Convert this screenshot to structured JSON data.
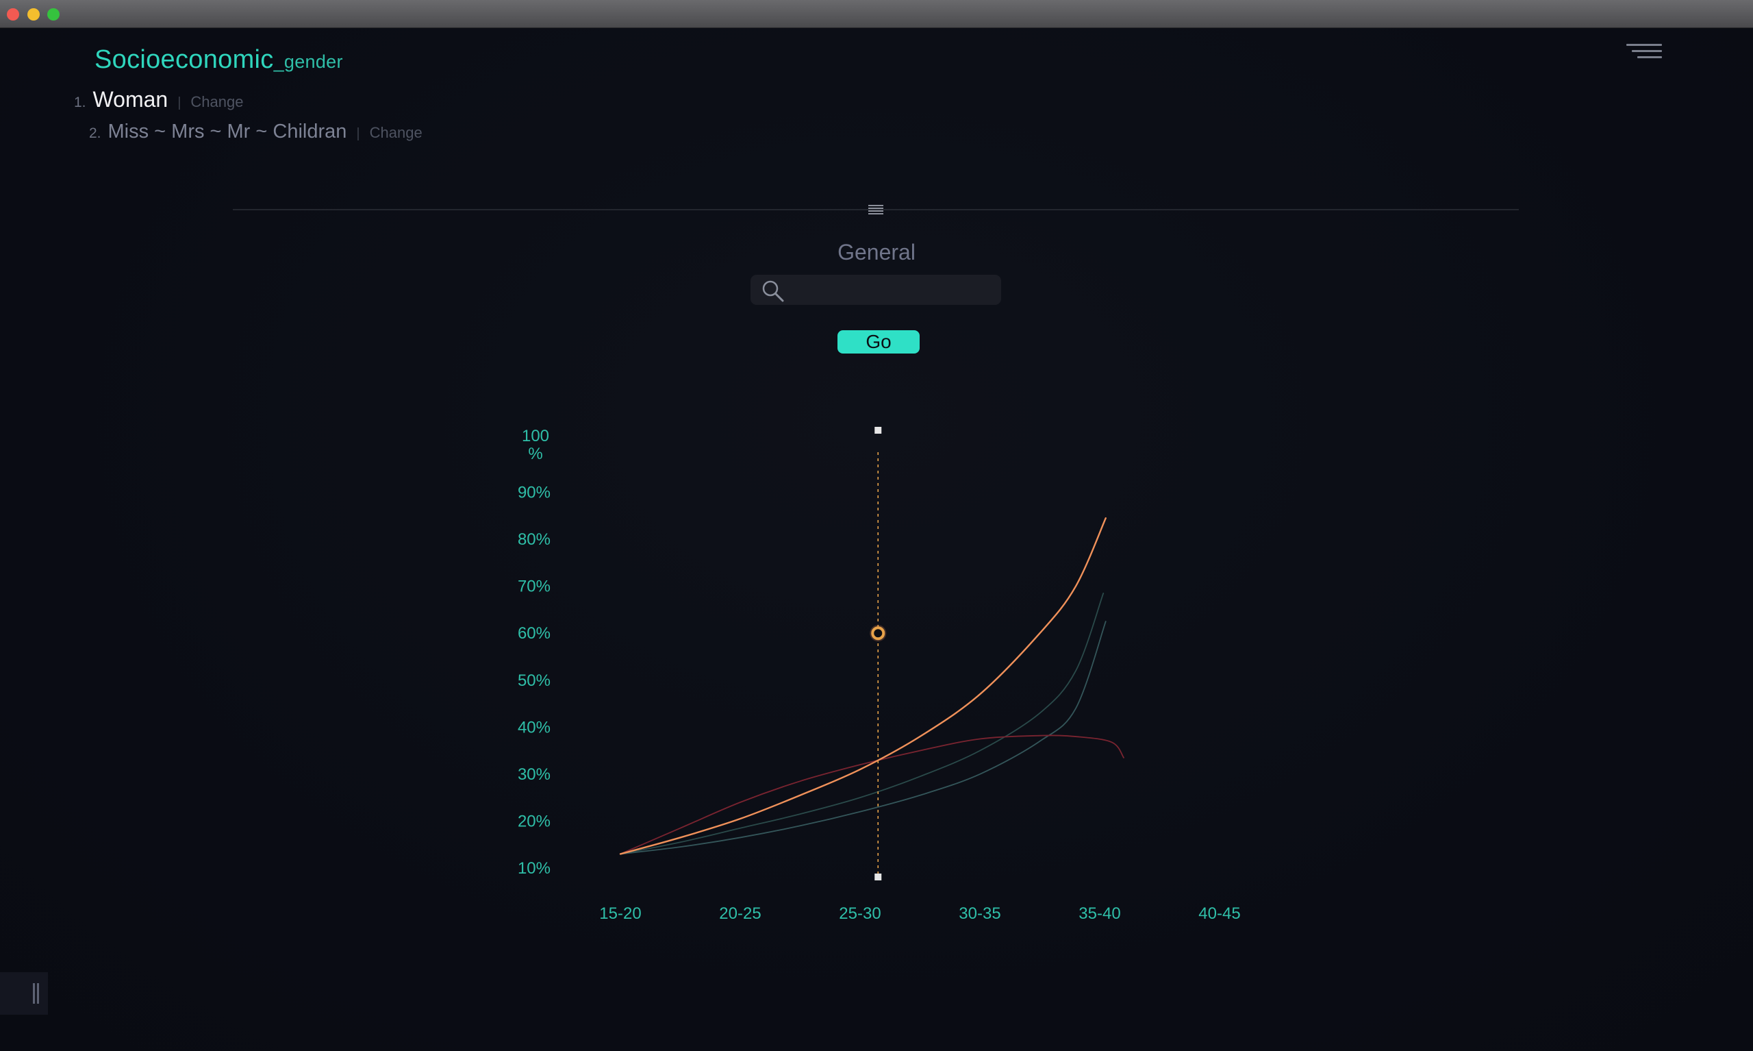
{
  "window": {
    "controls": [
      "close",
      "minimize",
      "maximize"
    ]
  },
  "header": {
    "title": "Socioeconomic",
    "title_suffix": "_gender",
    "steps": [
      {
        "number": "1.",
        "label": "Woman",
        "separator": "|",
        "action": "Change"
      },
      {
        "number": "2.",
        "label": "Miss ~ Mrs ~ Mr ~ Childran",
        "separator": "|",
        "action": "Change"
      }
    ]
  },
  "section": {
    "label": "General",
    "search": {
      "value": "",
      "placeholder": ""
    },
    "go_label": "Go"
  },
  "colors": {
    "accent": "#2fe0c6",
    "series_orange": "#f0915a",
    "series_red": "#7a2430",
    "series_teal_1": "#2a4a4a",
    "series_teal_2": "#34565a",
    "cursor": "#e8a34a"
  },
  "chart_data": {
    "type": "line",
    "title": "",
    "xlabel": "",
    "ylabel": "",
    "y_tick_labels": [
      "100 %",
      "90%",
      "80%",
      "70%",
      "60%",
      "50%",
      "40%",
      "30%",
      "20%",
      "10%"
    ],
    "categories": [
      "15-20",
      "20-25",
      "25-30",
      "30-35",
      "35-40",
      "40-45"
    ],
    "ylim": [
      10,
      100
    ],
    "grid": false,
    "legend": "none",
    "series": [
      {
        "color": "#f0915a",
        "width": 2.4,
        "points": [
          [
            0,
            13
          ],
          [
            0.5,
            16.5
          ],
          [
            1,
            20.5
          ],
          [
            1.5,
            25.5
          ],
          [
            2,
            31
          ],
          [
            2.5,
            38
          ],
          [
            3,
            47
          ],
          [
            3.5,
            60
          ],
          [
            3.8,
            70
          ],
          [
            4.05,
            84.5
          ]
        ]
      },
      {
        "color": "#7a2430",
        "width": 1.8,
        "points": [
          [
            0,
            13
          ],
          [
            0.5,
            18.5
          ],
          [
            1,
            24
          ],
          [
            1.5,
            28.5
          ],
          [
            2,
            32
          ],
          [
            2.5,
            35
          ],
          [
            3,
            37.5
          ],
          [
            3.5,
            38.2
          ],
          [
            3.8,
            38
          ],
          [
            4.1,
            36.8
          ],
          [
            4.2,
            33.5
          ]
        ]
      },
      {
        "color": "#2a4a4a",
        "width": 1.8,
        "points": [
          [
            0,
            13
          ],
          [
            0.5,
            15.5
          ],
          [
            1,
            18.5
          ],
          [
            1.5,
            21.5
          ],
          [
            2,
            25
          ],
          [
            2.5,
            29.5
          ],
          [
            3,
            35
          ],
          [
            3.5,
            43
          ],
          [
            3.8,
            52
          ],
          [
            4.03,
            68.5
          ]
        ]
      },
      {
        "color": "#34565a",
        "width": 1.8,
        "points": [
          [
            0,
            13
          ],
          [
            0.5,
            14.5
          ],
          [
            1,
            16.5
          ],
          [
            1.5,
            19
          ],
          [
            2,
            22
          ],
          [
            2.5,
            25.5
          ],
          [
            3,
            30
          ],
          [
            3.5,
            37
          ],
          [
            3.8,
            44
          ],
          [
            4.05,
            62.5
          ]
        ]
      }
    ],
    "cursor": {
      "x": 2.15,
      "y": 60,
      "color": "#e8a34a"
    }
  }
}
